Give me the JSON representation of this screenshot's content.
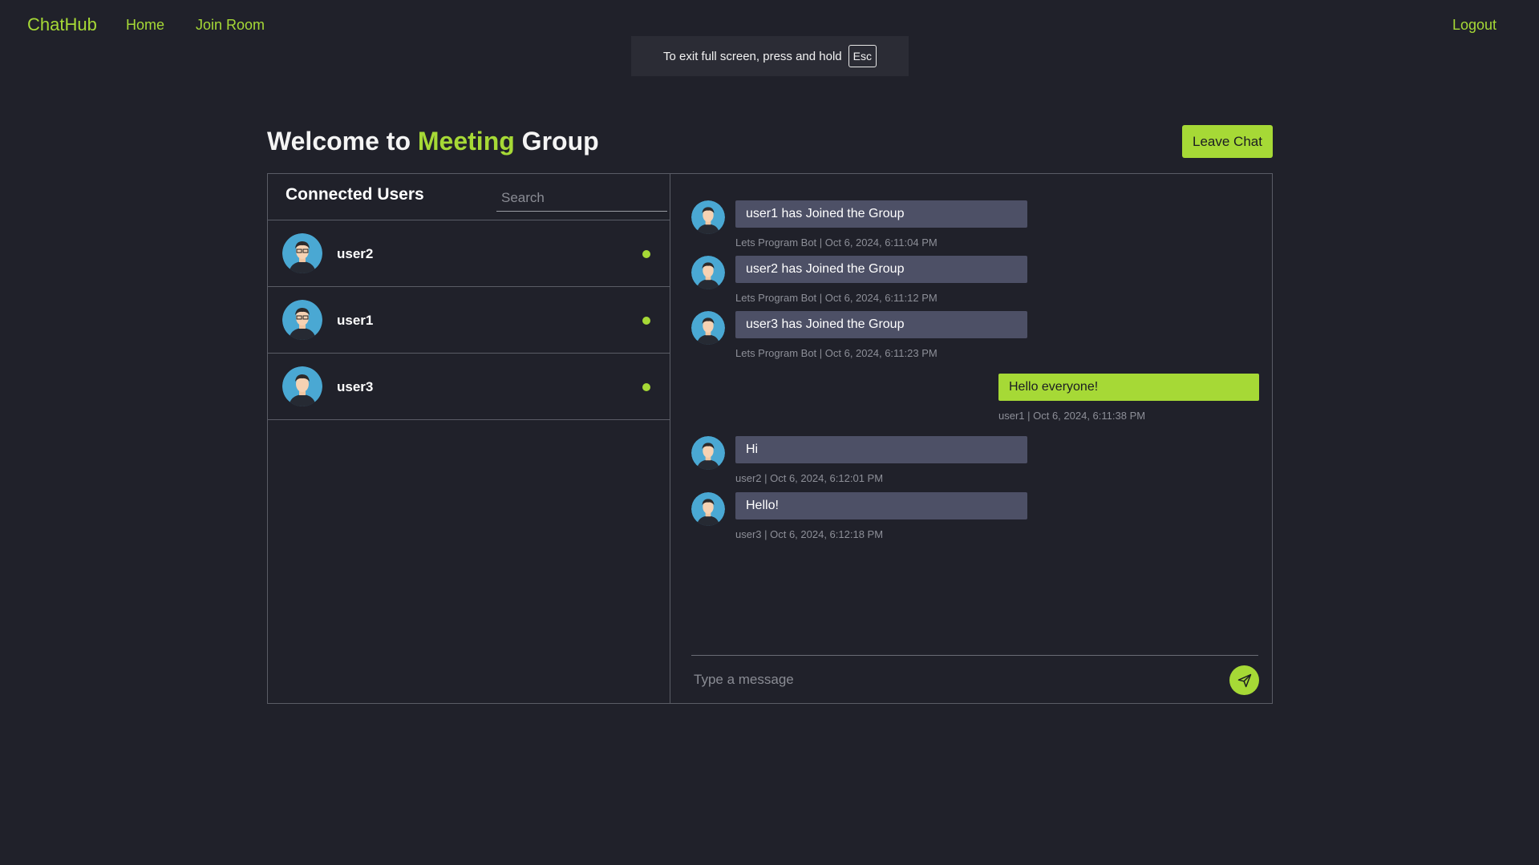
{
  "nav": {
    "brand": "ChatHub",
    "home": "Home",
    "join_room": "Join Room",
    "logout": "Logout"
  },
  "fullscreen_toast": {
    "text": "To exit full screen, press and hold",
    "key": "Esc"
  },
  "header": {
    "welcome_prefix": "Welcome to",
    "group_first": "Meeting",
    "group_rest": "Group",
    "leave_label": "Leave Chat"
  },
  "users_panel": {
    "title": "Connected Users",
    "search_placeholder": "Search",
    "users": [
      {
        "name": "user2",
        "status": "online"
      },
      {
        "name": "user1",
        "status": "online"
      },
      {
        "name": "user3",
        "status": "online"
      }
    ]
  },
  "chat": {
    "messages": [
      {
        "text": "user1 has Joined the Group",
        "meta": "Lets Program Bot | Oct 6, 2024, 6:11:04 PM",
        "own": false
      },
      {
        "text": "user2 has Joined the Group",
        "meta": "Lets Program Bot | Oct 6, 2024, 6:11:12 PM",
        "own": false
      },
      {
        "text": "user3 has Joined the Group",
        "meta": "Lets Program Bot | Oct 6, 2024, 6:11:23 PM",
        "own": false
      },
      {
        "text": "Hello everyone!",
        "meta": "user1 | Oct 6, 2024, 6:11:38 PM",
        "own": true
      },
      {
        "text": "Hi",
        "meta": "user2 | Oct 6, 2024, 6:12:01 PM",
        "own": false
      },
      {
        "text": "Hello!",
        "meta": "user3 | Oct 6, 2024, 6:12:18 PM",
        "own": false
      }
    ],
    "input_placeholder": "Type a message",
    "send_icon": "send-icon"
  },
  "colors": {
    "background": "#20212a",
    "accent": "#a6d936",
    "bubble": "#4d5066",
    "border": "#5a5c66",
    "online": "#a6d936"
  }
}
